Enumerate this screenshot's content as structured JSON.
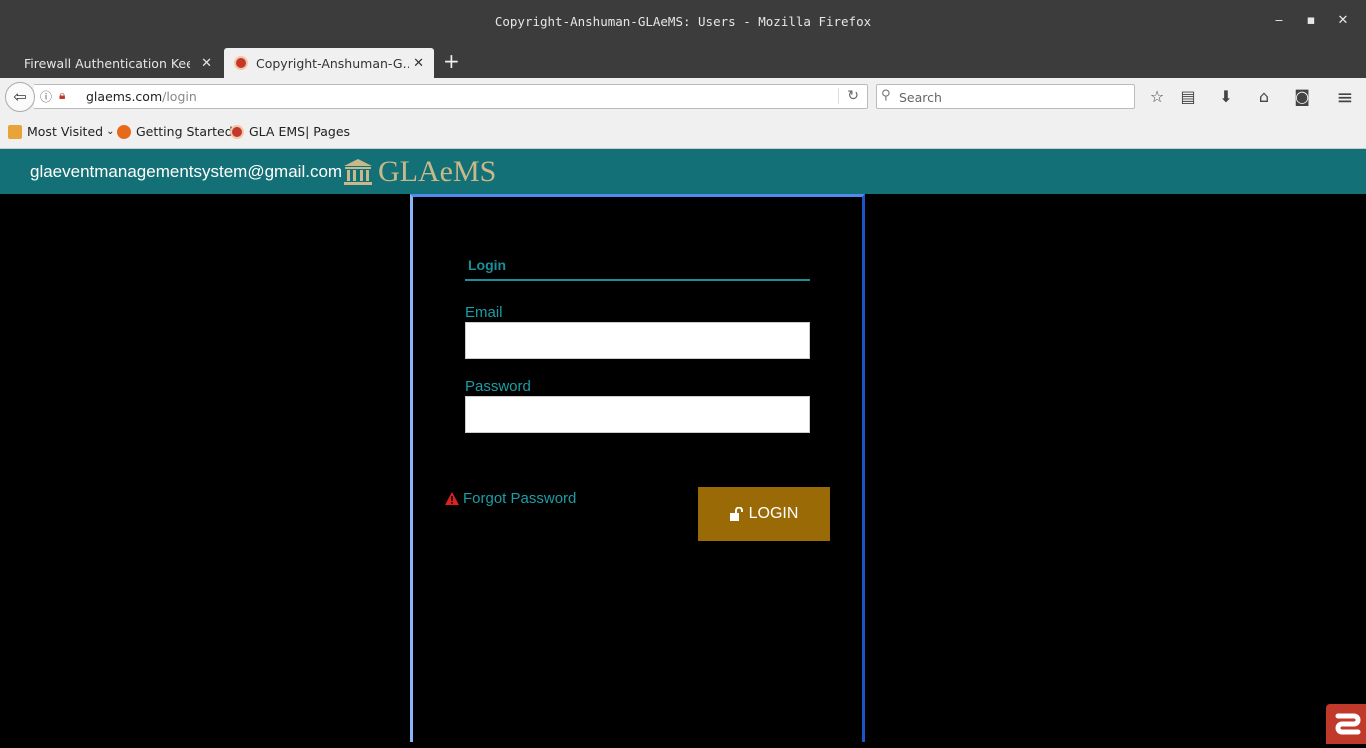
{
  "window": {
    "title": "Copyright-Anshuman-GLAeMS: Users - Mozilla Firefox",
    "minimize": "‒",
    "maximize": "▪",
    "close": "✕"
  },
  "tabs": [
    {
      "label": "Firewall Authentication Keep…",
      "close": "✕"
    },
    {
      "label": "Copyright-Anshuman-G…",
      "close": "✕"
    }
  ],
  "new_tab": "+",
  "nav": {
    "back": "⇦",
    "url_host": "glaems.com",
    "url_path": "/login",
    "reload": "↻",
    "search_placeholder": "Search"
  },
  "toolbar_icons": {
    "bookmark_star": "☆",
    "reading_list": "▤",
    "download": "⬇",
    "home": "⌂",
    "pocket": "◙",
    "menu": "≡"
  },
  "bookmarks": [
    {
      "label": "Most Visited",
      "suffix": "⌄"
    },
    {
      "label": "Getting Started"
    },
    {
      "label": "GLA EMS| Pages"
    }
  ],
  "header": {
    "email": "glaeventmanagementsystem@gmail.com",
    "logo_text": "GLAeMS"
  },
  "login": {
    "tab_label": "Login",
    "email_label": "Email",
    "email_value": "",
    "password_label": "Password",
    "password_value": "",
    "forgot_label": "Forgot Password",
    "button_label": "LOGIN"
  },
  "colors": {
    "header_bg": "#137076",
    "accent": "#1a9ea6",
    "button_bg": "#9a6a07",
    "logo": "#c9b98a"
  }
}
